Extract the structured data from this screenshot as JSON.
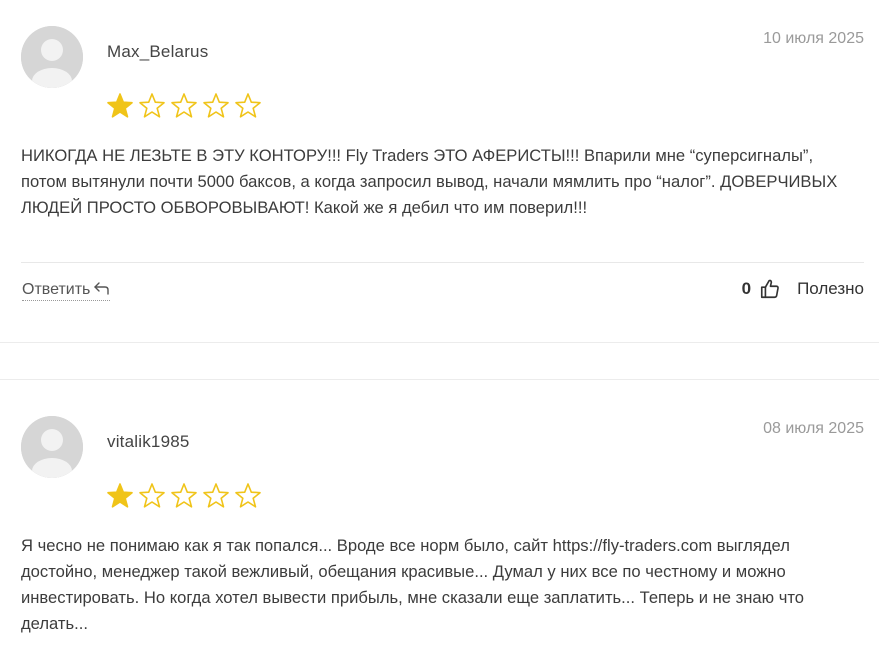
{
  "reviews": [
    {
      "username": "Max_Belarus",
      "date": "10 июля 2025",
      "rating": 1,
      "max_rating": 5,
      "text": "НИКОГДА НЕ ЛЕЗЬТЕ В ЭТУ КОНТОРУ!!! Fly Traders ЭТО АФЕРИСТЫ!!! Впарили мне “суперсигналы”, потом вытянули почти 5000 баксов, а когда запросил вывод, начали мямлить про “налог”. ДОВЕРЧИВЫХ ЛЮДЕЙ ПРОСТО ОБВОРОВЫВАЮТ! Какой же я дебил что им поверил!!!",
      "reply_label": "Ответить",
      "likes": "0",
      "helpful_label": "Полезно"
    },
    {
      "username": "vitalik1985",
      "date": "08 июля 2025",
      "rating": 1,
      "max_rating": 5,
      "text": "Я чесно не понимаю как я так попался... Вроде все норм было, сайт https://fly-traders.com выглядел достойно, менеджер такой вежливый, обещания красивые... Думал у них все по честному и можно инвестировать. Но когда хотел вывести прибыль, мне сказали еще заплатить... Теперь и не знаю что делать..."
    }
  ],
  "colors": {
    "star": "#f0c419",
    "avatar_bg": "#d6d6d6",
    "avatar_fg": "#f2f2f2",
    "date": "#9a9a9a"
  },
  "icons": {
    "avatar": "user-silhouette-icon",
    "star_filled": "star-filled-icon",
    "star_empty": "star-outline-icon",
    "reply": "reply-arrow-icon",
    "like": "thumbs-up-icon"
  }
}
